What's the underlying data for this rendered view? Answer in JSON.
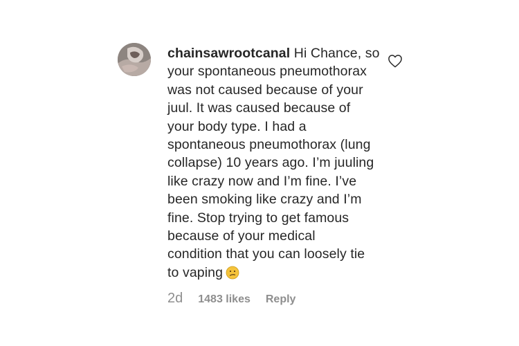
{
  "comment": {
    "username": "chainsawrootcanal",
    "text": "Hi Chance, so\nyour spontaneous pneumothorax\nwas not caused because of your\njuul. It was caused because of\nyour body type. I had a\nspontaneous pneumothorax (lung\ncollapse) 10 years ago. I’m juuling\nlike crazy now and I’m fine. I’ve\nbeen smoking like crazy and I’m\nfine. Stop trying to get famous\nbecause of your medical\ncondition that you can loosely tie\nto vaping",
    "emoji": "confused-face-emoji",
    "timestamp": "2d",
    "likes": "1483 likes",
    "reply_label": "Reply",
    "like_icon": "heart-outline-icon"
  },
  "colors": {
    "text": "#262626",
    "muted": "#8e8e8e",
    "emoji": "#f5c33b"
  }
}
